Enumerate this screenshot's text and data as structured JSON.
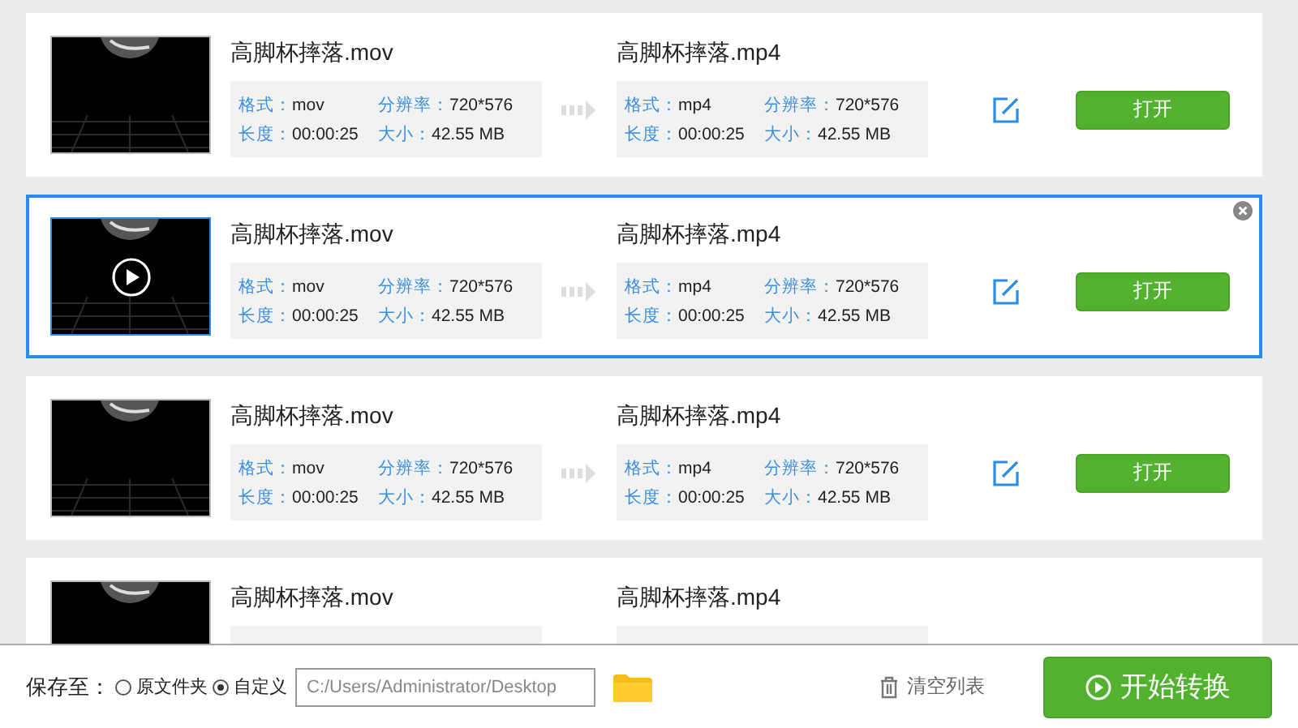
{
  "files": [
    {
      "selected": false,
      "source": {
        "name": "高脚杯摔落.mov",
        "info": [
          {
            "label": "格式：",
            "value": "mov"
          },
          {
            "label": "分辨率：",
            "value": "720*576"
          },
          {
            "label": "长度：",
            "value": "00:00:25"
          },
          {
            "label": "大小：",
            "value": "42.55 MB"
          }
        ]
      },
      "target": {
        "name": "高脚杯摔落.mp4",
        "info": [
          {
            "label": "格式：",
            "value": "mp4"
          },
          {
            "label": "分辨率：",
            "value": "720*576"
          },
          {
            "label": "长度：",
            "value": "00:00:25"
          },
          {
            "label": "大小：",
            "value": "42.55 MB"
          }
        ]
      },
      "open_button": "打开"
    },
    {
      "selected": true,
      "source": {
        "name": "高脚杯摔落.mov",
        "info": [
          {
            "label": "格式：",
            "value": "mov"
          },
          {
            "label": "分辨率：",
            "value": "720*576"
          },
          {
            "label": "长度：",
            "value": "00:00:25"
          },
          {
            "label": "大小：",
            "value": "42.55 MB"
          }
        ]
      },
      "target": {
        "name": "高脚杯摔落.mp4",
        "info": [
          {
            "label": "格式：",
            "value": "mp4"
          },
          {
            "label": "分辨率：",
            "value": "720*576"
          },
          {
            "label": "长度：",
            "value": "00:00:25"
          },
          {
            "label": "大小：",
            "value": "42.55 MB"
          }
        ]
      },
      "open_button": "打开"
    },
    {
      "selected": false,
      "source": {
        "name": "高脚杯摔落.mov",
        "info": [
          {
            "label": "格式：",
            "value": "mov"
          },
          {
            "label": "分辨率：",
            "value": "720*576"
          },
          {
            "label": "长度：",
            "value": "00:00:25"
          },
          {
            "label": "大小：",
            "value": "42.55 MB"
          }
        ]
      },
      "target": {
        "name": "高脚杯摔落.mp4",
        "info": [
          {
            "label": "格式：",
            "value": "mp4"
          },
          {
            "label": "分辨率：",
            "value": "720*576"
          },
          {
            "label": "长度：",
            "value": "00:00:25"
          },
          {
            "label": "大小：",
            "value": "42.55 MB"
          }
        ]
      },
      "open_button": "打开"
    },
    {
      "selected": false,
      "source": {
        "name": "高脚杯摔落.mov"
      },
      "target": {
        "name": "高脚杯摔落.mp4"
      }
    }
  ],
  "bottom_bar": {
    "save_to_label": "保存至：",
    "options": [
      {
        "label": "原文件夹",
        "selected": false
      },
      {
        "label": "自定义",
        "selected": true
      }
    ],
    "path": {
      "value": "C:/Users/Administrator/Desktop"
    },
    "clear_button": "清空列表",
    "start_button": "开始转换"
  }
}
